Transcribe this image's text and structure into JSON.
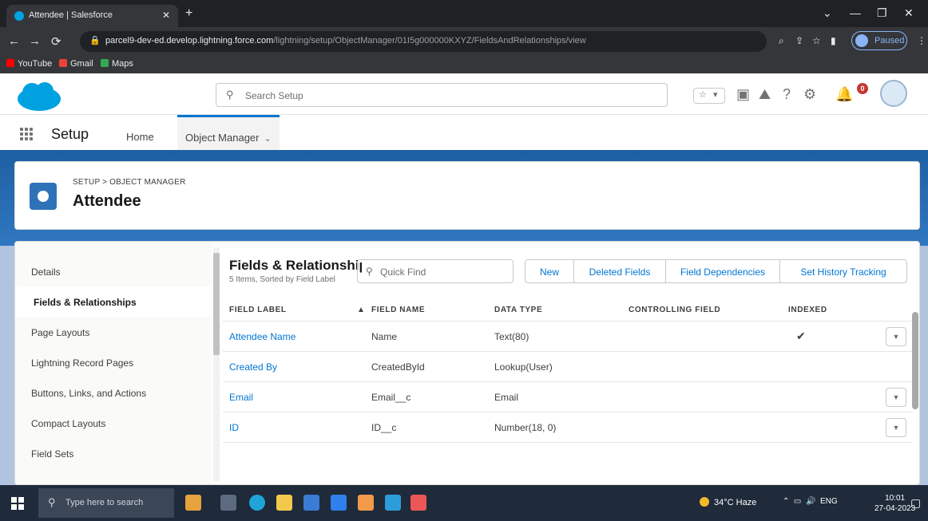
{
  "browser": {
    "tab_title": "Attendee | Salesforce",
    "url_host": "parcel9-dev-ed.develop.lightning.force.com",
    "url_path": "/lightning/setup/ObjectManager/01I5g000000KXYZ/FieldsAndRelationships/view",
    "bookmarks": [
      "YouTube",
      "Gmail",
      "Maps"
    ],
    "profile_label": "Paused"
  },
  "header": {
    "search_placeholder": "Search Setup",
    "notification_count": "0"
  },
  "nav": {
    "app_name": "Setup",
    "tabs": [
      {
        "label": "Home"
      },
      {
        "label": "Object Manager"
      }
    ]
  },
  "page": {
    "breadcrumb": "SETUP > OBJECT MANAGER",
    "object_name": "Attendee"
  },
  "sidebar": {
    "items": [
      {
        "label": "Details"
      },
      {
        "label": "Fields & Relationships"
      },
      {
        "label": "Page Layouts"
      },
      {
        "label": "Lightning Record Pages"
      },
      {
        "label": "Buttons, Links, and Actions"
      },
      {
        "label": "Compact Layouts"
      },
      {
        "label": "Field Sets"
      }
    ]
  },
  "section": {
    "title": "Fields & Relationships",
    "subtitle": "5 Items, Sorted by Field Label",
    "quick_find_placeholder": "Quick Find",
    "buttons": {
      "new": "New",
      "deleted_fields": "Deleted Fields",
      "field_dependencies": "Field Dependencies",
      "history_tracking": "Set History Tracking"
    }
  },
  "table": {
    "headers": {
      "field_label": "FIELD LABEL",
      "field_name": "FIELD NAME",
      "data_type": "DATA TYPE",
      "controlling_field": "CONTROLLING FIELD",
      "indexed": "INDEXED"
    },
    "rows": [
      {
        "label": "Attendee Name",
        "name": "Name",
        "type": "Text(80)",
        "controlling": "",
        "indexed": "✔"
      },
      {
        "label": "Created By",
        "name": "CreatedById",
        "type": "Lookup(User)",
        "controlling": "",
        "indexed": ""
      },
      {
        "label": "Email",
        "name": "Email__c",
        "type": "Email",
        "controlling": "",
        "indexed": ""
      },
      {
        "label": "ID",
        "name": "ID__c",
        "type": "Number(18, 0)",
        "controlling": "",
        "indexed": ""
      }
    ]
  },
  "taskbar": {
    "search_placeholder": "Type here to search",
    "weather": "34°C Haze",
    "lang": "ENG",
    "time": "10:01",
    "date": "27-04-2023"
  }
}
